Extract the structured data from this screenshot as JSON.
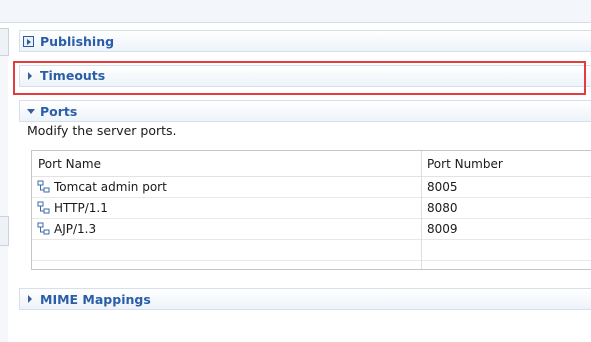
{
  "sections": {
    "publishing": {
      "title": "Publishing"
    },
    "timeouts": {
      "title": "Timeouts"
    },
    "ports": {
      "title": "Ports",
      "description": "Modify the server ports.",
      "columns": [
        "Port Name",
        "Port Number"
      ],
      "rows": [
        {
          "name": "Tomcat admin port",
          "number": "8005"
        },
        {
          "name": "HTTP/1.1",
          "number": "8080"
        },
        {
          "name": "AJP/1.3",
          "number": "8009"
        }
      ]
    },
    "mime": {
      "title": "MIME Mappings"
    }
  },
  "icons": {
    "publishing": "publish-icon",
    "port": "port-connector-icon",
    "collapsed": "triangle-right-icon",
    "expanded": "triangle-down-icon"
  },
  "colors": {
    "section_title": "#2a5ea8",
    "highlight": "#e23c3c"
  }
}
